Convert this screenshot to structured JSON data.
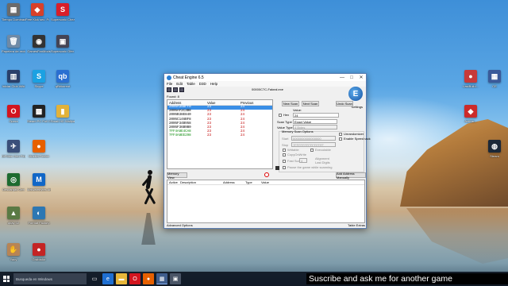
{
  "desktop_icons_left": [
    {
      "label": "Tiempo Dominación",
      "glyph": "▦",
      "color": "#6b6b6b",
      "icon": "app-icon"
    },
    {
      "label": "Free Kick sec. Poweret...",
      "glyph": "◆",
      "color": "#d8402a",
      "icon": "app-icon"
    },
    {
      "label": "Supersonic Cheat Engine",
      "glyph": "S",
      "color": "#d81e2a",
      "icon": "app-icon"
    },
    {
      "label": "Papelera de reciclaje",
      "glyph": "🗑",
      "color": "#6f8aa6",
      "icon": "recycle-bin-icon"
    },
    {
      "label": "GamesFanMods",
      "glyph": "◉",
      "color": "#333",
      "icon": "app-icon"
    },
    {
      "label": "Supersonic Ofer...",
      "glyph": "▣",
      "color": "#445",
      "icon": "app-icon"
    },
    {
      "label": "Iniciar Club Wiki",
      "glyph": "▥",
      "color": "#2a3f6a",
      "icon": "app-icon"
    },
    {
      "label": "Skype",
      "glyph": "S",
      "color": "#1ba1e2",
      "icon": "skype-icon"
    },
    {
      "label": "qBittorrent",
      "glyph": "qb",
      "color": "#2a6fd1",
      "icon": "qbittorrent-icon"
    },
    {
      "label": "Opera",
      "glyph": "O",
      "color": "#d3151f",
      "icon": "opera-icon"
    },
    {
      "label": "Steam PC Full CP",
      "glyph": "▩",
      "color": "#222",
      "icon": "app-icon"
    },
    {
      "label": "Small HD Wallpaper",
      "glyph": "▮",
      "color": "#e2b23a",
      "icon": "folder-icon"
    },
    {
      "label": "DiFMan Gen Plus",
      "glyph": "✈",
      "color": "#3a4f7a",
      "icon": "app-icon"
    },
    {
      "label": "Mozilla Firefox",
      "glyph": "●",
      "color": "#e66000",
      "icon": "firefox-icon"
    },
    {
      "label": "Descargas Gen",
      "glyph": "◎",
      "color": "#1d6b2f",
      "icon": "app-icon"
    },
    {
      "label": "Malwarebytes Anti-Malware",
      "glyph": "M",
      "color": "#1167c7",
      "icon": "malwarebytes-icon"
    },
    {
      "label": "qbay 02",
      "glyph": "▲",
      "color": "#5a7a44",
      "icon": "app-icon"
    },
    {
      "label": "Format Factory",
      "glyph": "◐",
      "color": "#2d77b3",
      "icon": "app-icon"
    },
    {
      "label": "Yaoy",
      "glyph": "✋",
      "color": "#b78455",
      "icon": "app-icon"
    },
    {
      "label": "Grabador",
      "glyph": "●",
      "color": "#c42424",
      "icon": "app-icon"
    }
  ],
  "desktop_icons_right": [
    {
      "label": "LastBuild...",
      "glyph": "●",
      "color": "#c83a3a",
      "icon": "app-icon"
    },
    {
      "label": "CE",
      "glyph": "▦",
      "color": "#3a5a9a",
      "icon": "app-icon"
    },
    {
      "label": "Activar...",
      "glyph": "◆",
      "color": "#cc2b2b",
      "icon": "app-icon"
    },
    {
      "label": "Steam",
      "glyph": "◍",
      "color": "#1b2838",
      "icon": "steam-icon"
    }
  ],
  "cheat_engine": {
    "title": "Cheat Engine 6.5",
    "menu": [
      "File",
      "Edit",
      "Table",
      "D3D",
      "Help"
    ],
    "process": "00000C7C-Fakeal.exe",
    "found": "Found: 8",
    "settings_label": "Settings",
    "logo_letter": "E",
    "results": {
      "headers": [
        "Address",
        "Value",
        "Previous"
      ],
      "rows": [
        {
          "address": "2005A35BFF0",
          "value": "23",
          "previous": "24",
          "selected": true,
          "green": false
        },
        {
          "address": "2005AF2C3B8",
          "value": "23",
          "previous": "24",
          "selected": false,
          "green": false
        },
        {
          "address": "2005B38E840",
          "value": "23",
          "previous": "24",
          "selected": false,
          "green": false
        },
        {
          "address": "2005C146BF8",
          "value": "23",
          "previous": "24",
          "selected": false,
          "green": false
        },
        {
          "address": "2005F34B958",
          "value": "23",
          "previous": "24",
          "selected": false,
          "green": false
        },
        {
          "address": "2005F36B9B0",
          "value": "23",
          "previous": "24",
          "selected": false,
          "green": false
        },
        {
          "address": "7FF4A8E4CA8",
          "value": "23",
          "previous": "24",
          "selected": false,
          "green": true
        },
        {
          "address": "7FF4A8EE298",
          "value": "23",
          "previous": "24",
          "selected": false,
          "green": true
        }
      ]
    },
    "new_scan": "New Scan",
    "next_scan": "Next Scan",
    "undo_scan": "Undo Scan",
    "value_label": "Value:",
    "hex_label": "Hex",
    "value_input": "24",
    "scan_type_label": "Scan Type",
    "scan_type": "Exact Value",
    "value_type_label": "Value Type",
    "value_type": "4 Bytes",
    "memory_scan_options": "Memory Scan Options",
    "start_label": "Start",
    "start_value": "0000000000000000",
    "stop_label": "Stop",
    "stop_value": "7FFFFFFFFFFFFFFF",
    "writable": "Writable",
    "executable": "Executable",
    "copyonwrite": "CopyOnWrite",
    "fast_scan": "Fast Scan",
    "fast_scan_value": "4",
    "alignment": "Alignment",
    "last_digits": "Last Digits",
    "pause_game": "Pause the game while scanning",
    "unrandomizer": "Unrandomizer",
    "enable_speedhack": "Enable Speedhack",
    "memory_view": "Memory View",
    "add_address_manually": "Add Address Manually",
    "table_headers": [
      "Active",
      "Description",
      "Address",
      "Type",
      "Value"
    ],
    "advanced_options": "Advanced Options",
    "table_extras": "Table Extras"
  },
  "taskbar": {
    "search_placeholder": "Busqueda en Windows",
    "apps": [
      {
        "icon": "task-view-icon",
        "glyph": "▭",
        "color": "transparent"
      },
      {
        "icon": "edge-icon",
        "glyph": "e",
        "color": "#1f6fd1"
      },
      {
        "icon": "file-explorer-icon",
        "glyph": "▬",
        "color": "#e8b73a"
      },
      {
        "icon": "opera-icon",
        "glyph": "O",
        "color": "#d3151f"
      },
      {
        "icon": "firefox-icon",
        "glyph": "●",
        "color": "#e66000"
      },
      {
        "icon": "cheat-engine-icon",
        "glyph": "▦",
        "color": "#3f5d8c"
      },
      {
        "icon": "app-icon",
        "glyph": "▣",
        "color": "#4a5566"
      }
    ]
  },
  "overlay_caption": "Suscribe and ask me for another game"
}
